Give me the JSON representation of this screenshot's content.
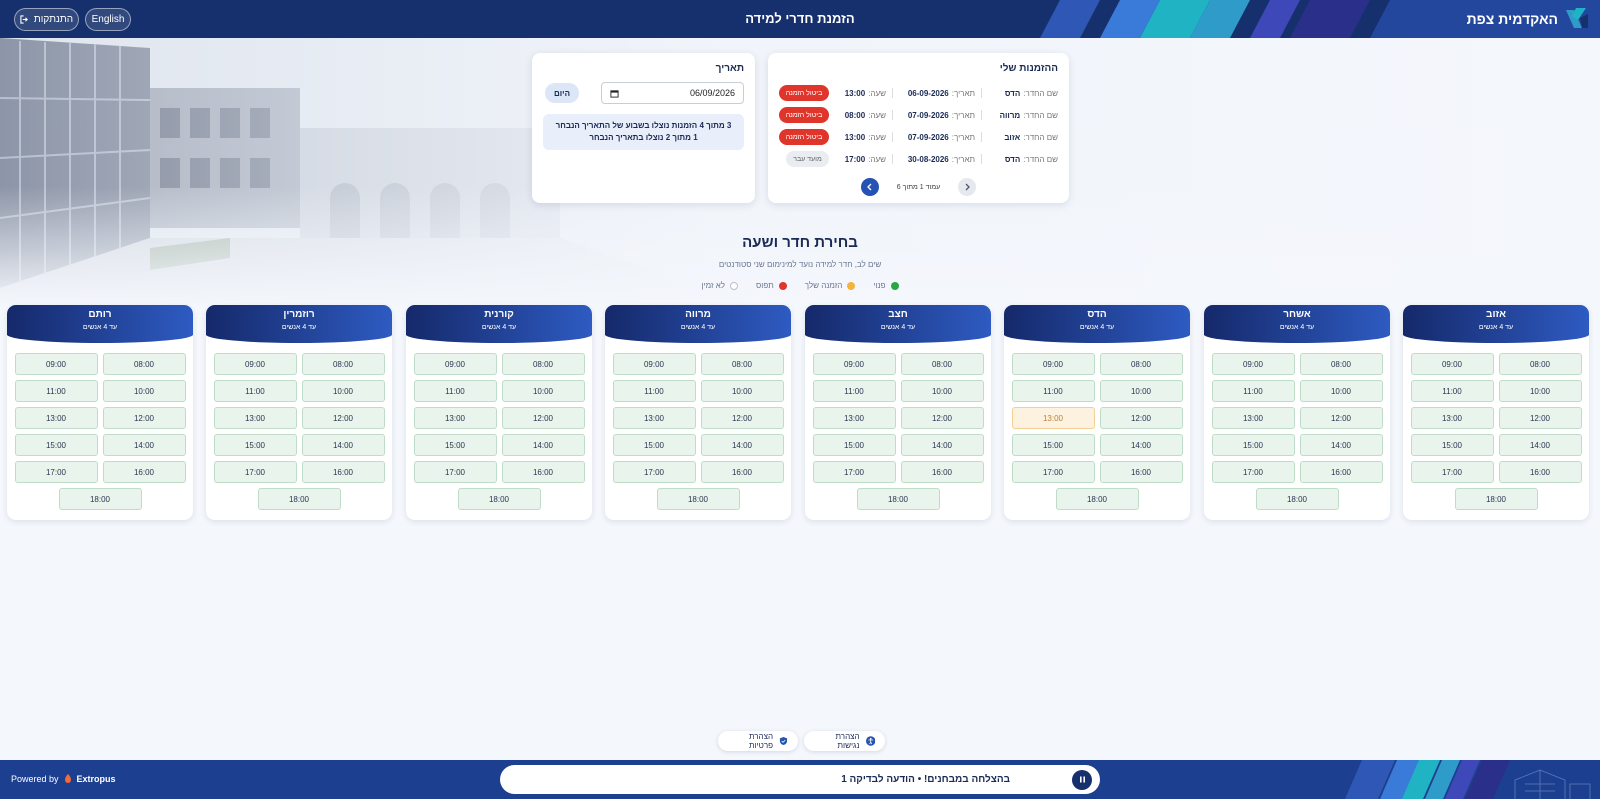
{
  "header": {
    "brand": "האקדמית צפת",
    "title": "הזמנת חדרי למידה",
    "logout_label": "התנתקות",
    "lang_label": "English"
  },
  "bookings": {
    "title": "ההזמנות שלי",
    "room_label": "שם החדר:",
    "date_label": "תאריך:",
    "time_label": "שעה:",
    "cancel_label": "ביטול הזמנה",
    "rows": [
      {
        "room": "הדס",
        "date": "06-09-2026",
        "time": "13:00",
        "action": "ביטול הזמנה",
        "past": false
      },
      {
        "room": "מרווה",
        "date": "07-09-2026",
        "time": "08:00",
        "action": "ביטול הזמנה",
        "past": false
      },
      {
        "room": "אזוב",
        "date": "07-09-2026",
        "time": "13:00",
        "action": "ביטול הזמנה",
        "past": false
      },
      {
        "room": "הדס",
        "date": "30-08-2026",
        "time": "17:00",
        "action": "מועד עבר",
        "past": true
      }
    ],
    "pager": "עמוד 1 מתוך 6"
  },
  "date_panel": {
    "title": "תאריך",
    "date_value": "06/09/2026",
    "today_label": "היום",
    "info_line1": "3 מתוך 4 הזמנות נוצלו בשבוע של התאריך הנבחר",
    "info_line2": "1 מתוך 2 נוצלו בתאריך הנבחר"
  },
  "selection": {
    "title": "בחירת חדר ושעה",
    "subtitle": "שים לב, חדר למידה נועד למינימום שני סטודנטים",
    "legend": [
      {
        "label": "פנוי",
        "color": "#27a745"
      },
      {
        "label": "הזמנה שלך",
        "color": "#f3b33d"
      },
      {
        "label": "תפוס",
        "color": "#e0352b"
      },
      {
        "label": "לא זמין",
        "color": "#ffffff"
      }
    ]
  },
  "capacity_label": "עד 4 אנשים",
  "rooms": [
    {
      "name": "אזוב",
      "mine": []
    },
    {
      "name": "אשחר",
      "mine": []
    },
    {
      "name": "הדס",
      "mine": [
        "13:00"
      ]
    },
    {
      "name": "חצב",
      "mine": []
    },
    {
      "name": "מרווה",
      "mine": []
    },
    {
      "name": "קורנית",
      "mine": []
    },
    {
      "name": "רוזמרין",
      "mine": []
    },
    {
      "name": "רותם",
      "mine": []
    }
  ],
  "slot_times": [
    "08:00",
    "09:00",
    "10:00",
    "11:00",
    "12:00",
    "13:00",
    "14:00",
    "15:00",
    "16:00",
    "17:00",
    "18:00"
  ],
  "footer_links": {
    "accessibility": "הצהרת נגישות",
    "privacy": "הצהרת פרטיות"
  },
  "footer": {
    "powered_by": "Powered by",
    "company": "Extropus",
    "ticker": "בהצלחה במבחנים! • הודעה לבדיקה 1"
  },
  "colors": {
    "primary": "#16306d",
    "accent": "#2453b3",
    "danger": "#e0352b",
    "available_bg": "#e9f5ec",
    "mine_bg": "#fdf2df"
  }
}
